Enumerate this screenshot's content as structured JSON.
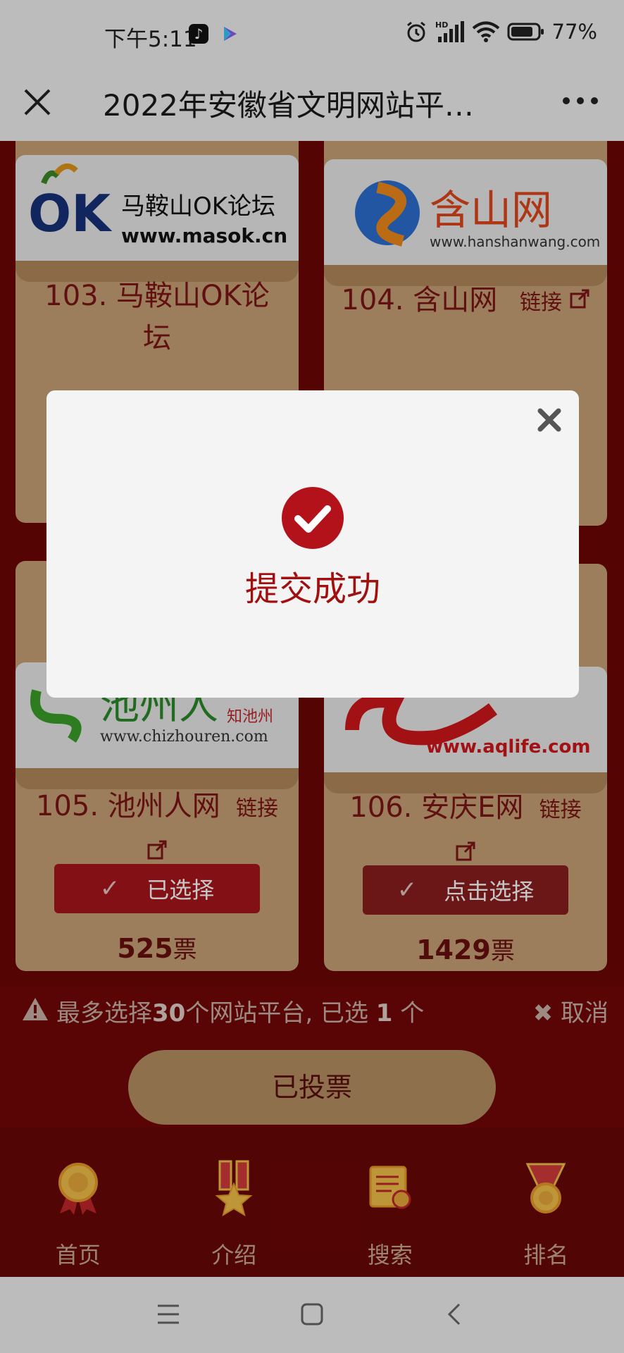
{
  "status": {
    "time": "下午5:11",
    "battery": "77%",
    "network": "HD"
  },
  "header": {
    "title": "2022年安徽省文明网站平…"
  },
  "cards": [
    {
      "logo_text": "马鞍山OK论坛",
      "logo_url": "www.masok.cn",
      "name": "103. 马鞍山OK论坛"
    },
    {
      "logo_text": "含山网",
      "logo_url": "www.hanshanwang.com",
      "name": "104. 含山网",
      "link": "链接"
    },
    {
      "logo_text": "池州人",
      "logo_sub": "知池州",
      "logo_url": "www.chizhouren.com",
      "name": "105. 池州人网",
      "link": "链接",
      "button": "已选择",
      "votes": "525",
      "votes_unit": "票"
    },
    {
      "logo_url": "www.aqlife.com",
      "name": "106. 安庆E网",
      "link": "链接",
      "button": "点击选择",
      "votes": "1429",
      "votes_unit": "票"
    }
  ],
  "selection": {
    "prefix": "最多选择",
    "max": "30",
    "middle": "个网站平台, 已选",
    "count": "1",
    "suffix": "个",
    "cancel": "取消"
  },
  "vote_button": "已投票",
  "nav": [
    {
      "label": "首页",
      "icon": "medal-icon"
    },
    {
      "label": "介绍",
      "icon": "star-ribbon-icon"
    },
    {
      "label": "搜索",
      "icon": "certificate-icon"
    },
    {
      "label": "排名",
      "icon": "medal-ranking-icon"
    }
  ],
  "modal": {
    "message": "提交成功"
  },
  "colors": {
    "brand_red": "#a10f0f",
    "card_tan": "#c8a277",
    "page_bg": "#6e0606"
  }
}
